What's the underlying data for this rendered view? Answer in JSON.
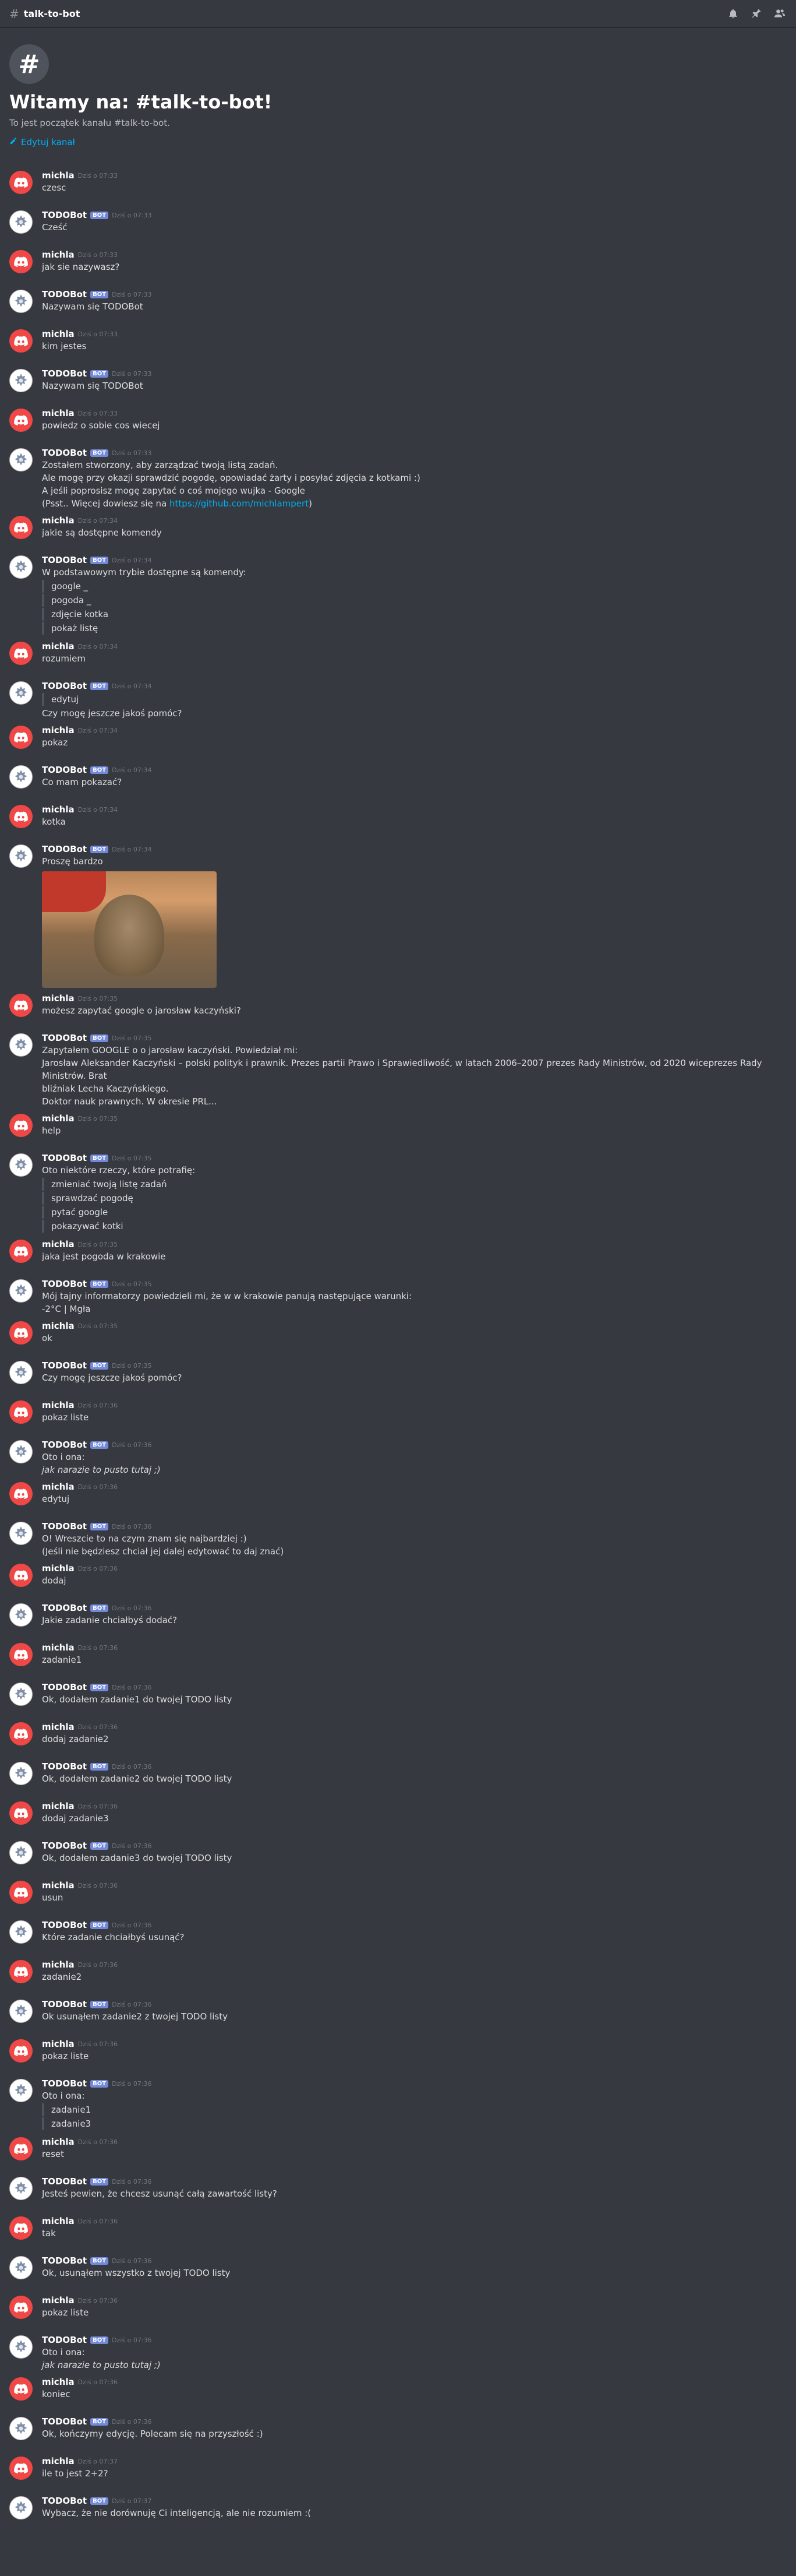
{
  "topbar": {
    "channel": "talk-to-bot"
  },
  "welcome": {
    "title": "Witamy na: #talk-to-bot!",
    "subtitle": "To jest początek kanału #talk-to-bot.",
    "edit_label": "Edytuj kanał"
  },
  "messages": [
    {
      "author": "michla",
      "bot": false,
      "ts": "Dziś o 07:33",
      "lines": [
        "czesc"
      ]
    },
    {
      "author": "TODOBot",
      "bot": true,
      "ts": "Dziś o 07:33",
      "lines": [
        "Cześć"
      ]
    },
    {
      "author": "michla",
      "bot": false,
      "ts": "Dziś o 07:33",
      "lines": [
        "jak sie nazywasz?"
      ]
    },
    {
      "author": "TODOBot",
      "bot": true,
      "ts": "Dziś o 07:33",
      "lines": [
        "Nazywam się TODOBot"
      ]
    },
    {
      "author": "michla",
      "bot": false,
      "ts": "Dziś o 07:33",
      "lines": [
        "kim jestes"
      ]
    },
    {
      "author": "TODOBot",
      "bot": true,
      "ts": "Dziś o 07:33",
      "lines": [
        "Nazywam się TODOBot"
      ]
    },
    {
      "author": "michla",
      "bot": false,
      "ts": "Dziś o 07:33",
      "lines": [
        "powiedz o sobie cos wiecej"
      ]
    },
    {
      "author": "TODOBot",
      "bot": true,
      "ts": "Dziś o 07:33",
      "lines": [
        "Zostałem stworzony, aby zarządzać twoją listą zadań.",
        "Ale mogę przy okazji sprawdzić pogodę, opowiadać żarty i posyłać zdjęcia z kotkami :)",
        "A jeśli poprosisz mogę zapytać o coś mojego wujka - Google"
      ],
      "link_prefix": "(Psst.. Więcej dowiesz się na ",
      "link": "https://github.com/michlampert",
      "link_suffix": ")"
    },
    {
      "author": "michla",
      "bot": false,
      "ts": "Dziś o 07:34",
      "lines": [
        "jakie są dostępne komendy"
      ]
    },
    {
      "author": "TODOBot",
      "bot": true,
      "ts": "Dziś o 07:34",
      "lines": [
        "W podstawowym trybie dostępne są komendy:"
      ],
      "quotes": [
        "google _",
        "pogoda _",
        "zdjęcie kotka",
        "pokaż listę"
      ]
    },
    {
      "author": "michla",
      "bot": false,
      "ts": "Dziś o 07:34",
      "lines": [
        "rozumiem"
      ]
    },
    {
      "author": "TODOBot",
      "bot": true,
      "ts": "Dziś o 07:34",
      "quotes_first": [
        "edytuj"
      ],
      "lines": [
        "Czy mogę jeszcze jakoś pomóc?"
      ]
    },
    {
      "author": "michla",
      "bot": false,
      "ts": "Dziś o 07:34",
      "lines": [
        "pokaz"
      ]
    },
    {
      "author": "TODOBot",
      "bot": true,
      "ts": "Dziś o 07:34",
      "lines": [
        "Co mam pokazać?"
      ]
    },
    {
      "author": "michla",
      "bot": false,
      "ts": "Dziś o 07:34",
      "lines": [
        "kotka"
      ]
    },
    {
      "author": "TODOBot",
      "bot": true,
      "ts": "Dziś o 07:34",
      "lines": [
        "Proszę bardzo"
      ],
      "image": true
    },
    {
      "author": "michla",
      "bot": false,
      "ts": "Dziś o 07:35",
      "lines": [
        "możesz zapytać google o jarosław kaczyński?"
      ]
    },
    {
      "author": "TODOBot",
      "bot": true,
      "ts": "Dziś o 07:35",
      "lines": [
        "Zapytałem GOOGLE o o jarosław kaczyński. Powiedział mi:",
        "Jarosław Aleksander Kaczyński – polski polityk i prawnik. Prezes partii Prawo i Sprawiedliwość, w latach 2006–2007 prezes Rady Ministrów, od 2020 wiceprezes Rady Ministrów. Brat",
        "bliźniak Lecha Kaczyńskiego.",
        "Doktor nauk prawnych. W okresie PRL..."
      ]
    },
    {
      "author": "michla",
      "bot": false,
      "ts": "Dziś o 07:35",
      "lines": [
        "help"
      ]
    },
    {
      "author": "TODOBot",
      "bot": true,
      "ts": "Dziś o 07:35",
      "lines": [
        "Oto niektóre rzeczy, które potrafię:"
      ],
      "quotes": [
        "zmieniać twoją listę zadań",
        "sprawdzać pogodę",
        "pytać google",
        "pokazywać kotki"
      ]
    },
    {
      "author": "michla",
      "bot": false,
      "ts": "Dziś o 07:35",
      "lines": [
        "jaka jest pogoda w krakowie"
      ]
    },
    {
      "author": "TODOBot",
      "bot": true,
      "ts": "Dziś o 07:35",
      "lines": [
        "Mój tajny informatorzy powiedzieli mi, że w w krakowie panują następujące warunki:",
        "-2°C | Mgła"
      ]
    },
    {
      "author": "michla",
      "bot": false,
      "ts": "Dziś o 07:35",
      "lines": [
        "ok"
      ]
    },
    {
      "author": "TODOBot",
      "bot": true,
      "ts": "Dziś o 07:35",
      "lines": [
        "Czy mogę jeszcze jakoś pomóc?"
      ]
    },
    {
      "author": "michla",
      "bot": false,
      "ts": "Dziś o 07:36",
      "lines": [
        "pokaz liste"
      ]
    },
    {
      "author": "TODOBot",
      "bot": true,
      "ts": "Dziś o 07:36",
      "lines": [
        "Oto i ona:"
      ],
      "italic": "jak narazie to pusto tutaj ;)"
    },
    {
      "author": "michla",
      "bot": false,
      "ts": "Dziś o 07:36",
      "lines": [
        "edytuj"
      ]
    },
    {
      "author": "TODOBot",
      "bot": true,
      "ts": "Dziś o 07:36",
      "lines": [
        "O! Wreszcie to na czym znam się najbardziej :)",
        "(Jeśli nie będziesz chciał jej dalej edytować to daj znać)"
      ]
    },
    {
      "author": "michla",
      "bot": false,
      "ts": "Dziś o 07:36",
      "lines": [
        "dodaj"
      ]
    },
    {
      "author": "TODOBot",
      "bot": true,
      "ts": "Dziś o 07:36",
      "lines": [
        "Jakie zadanie chciałbyś dodać?"
      ]
    },
    {
      "author": "michla",
      "bot": false,
      "ts": "Dziś o 07:36",
      "lines": [
        "zadanie1"
      ]
    },
    {
      "author": "TODOBot",
      "bot": true,
      "ts": "Dziś o 07:36",
      "lines": [
        "Ok, dodałem zadanie1 do twojej TODO listy"
      ]
    },
    {
      "author": "michla",
      "bot": false,
      "ts": "Dziś o 07:36",
      "lines": [
        "dodaj zadanie2"
      ]
    },
    {
      "author": "TODOBot",
      "bot": true,
      "ts": "Dziś o 07:36",
      "lines": [
        "Ok, dodałem zadanie2 do twojej TODO listy"
      ]
    },
    {
      "author": "michla",
      "bot": false,
      "ts": "Dziś o 07:36",
      "lines": [
        "dodaj zadanie3"
      ]
    },
    {
      "author": "TODOBot",
      "bot": true,
      "ts": "Dziś o 07:36",
      "lines": [
        "Ok, dodałem zadanie3 do twojej TODO listy"
      ]
    },
    {
      "author": "michla",
      "bot": false,
      "ts": "Dziś o 07:36",
      "lines": [
        "usun"
      ]
    },
    {
      "author": "TODOBot",
      "bot": true,
      "ts": "Dziś o 07:36",
      "lines": [
        "Które zadanie chciałbyś usunąć?"
      ]
    },
    {
      "author": "michla",
      "bot": false,
      "ts": "Dziś o 07:36",
      "lines": [
        "zadanie2"
      ]
    },
    {
      "author": "TODOBot",
      "bot": true,
      "ts": "Dziś o 07:36",
      "lines": [
        "Ok usunąłem zadanie2 z twojej TODO listy"
      ]
    },
    {
      "author": "michla",
      "bot": false,
      "ts": "Dziś o 07:36",
      "lines": [
        "pokaz liste"
      ]
    },
    {
      "author": "TODOBot",
      "bot": true,
      "ts": "Dziś o 07:36",
      "lines": [
        "Oto i ona:"
      ],
      "quotes": [
        "zadanie1",
        "zadanie3"
      ]
    },
    {
      "author": "michla",
      "bot": false,
      "ts": "Dziś o 07:36",
      "lines": [
        "reset"
      ]
    },
    {
      "author": "TODOBot",
      "bot": true,
      "ts": "Dziś o 07:36",
      "lines": [
        "Jesteś pewien, że chcesz usunąć całą zawartość listy?"
      ]
    },
    {
      "author": "michla",
      "bot": false,
      "ts": "Dziś o 07:36",
      "lines": [
        "tak"
      ]
    },
    {
      "author": "TODOBot",
      "bot": true,
      "ts": "Dziś o 07:36",
      "lines": [
        "Ok, usunąłem wszystko z twojej TODO listy"
      ]
    },
    {
      "author": "michla",
      "bot": false,
      "ts": "Dziś o 07:36",
      "lines": [
        "pokaz liste"
      ]
    },
    {
      "author": "TODOBot",
      "bot": true,
      "ts": "Dziś o 07:36",
      "lines": [
        "Oto i ona:"
      ],
      "italic": "jak narazie to pusto tutaj ;)"
    },
    {
      "author": "michla",
      "bot": false,
      "ts": "Dziś o 07:36",
      "lines": [
        "koniec"
      ]
    },
    {
      "author": "TODOBot",
      "bot": true,
      "ts": "Dziś o 07:36",
      "lines": [
        "Ok, kończymy edycję. Polecam się na przyszłość :)"
      ]
    },
    {
      "author": "michla",
      "bot": false,
      "ts": "Dziś o 07:37",
      "lines": [
        "ile to jest 2+2?"
      ]
    },
    {
      "author": "TODOBot",
      "bot": true,
      "ts": "Dziś o 07:37",
      "lines": [
        "Wybacz, że nie dorównuję Ci inteligencją, ale nie rozumiem :("
      ]
    }
  ],
  "labels": {
    "bot_tag": "BOT"
  }
}
